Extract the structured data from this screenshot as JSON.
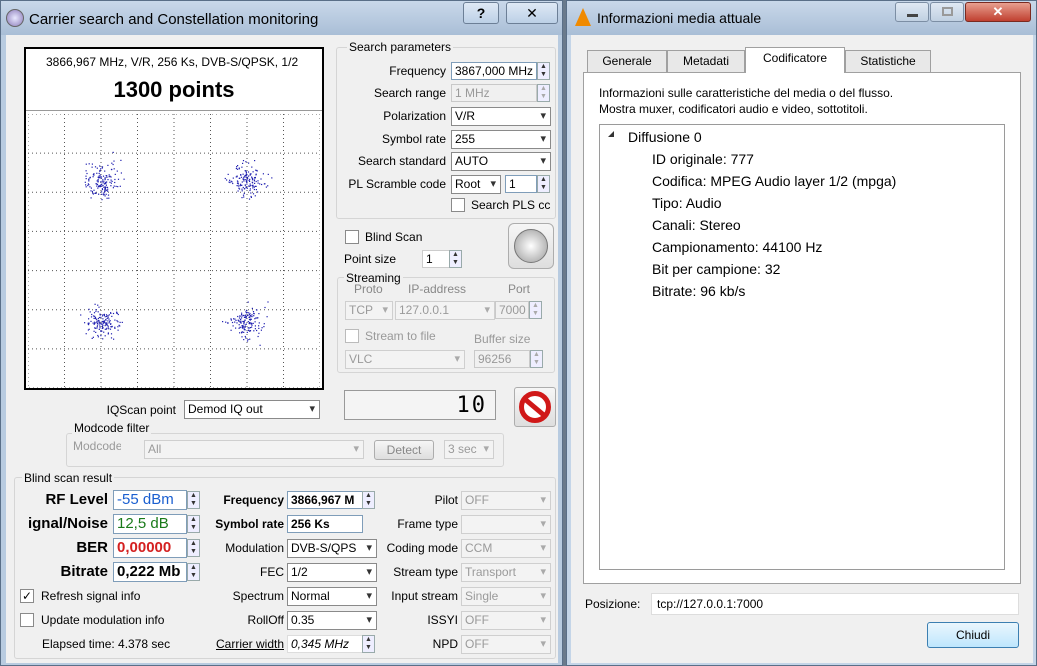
{
  "left": {
    "title": "Carrier search and Constellation monitoring",
    "help_glyph": "?",
    "close_glyph": "✕",
    "constellation": {
      "info": "3866,967 MHz, V/R, 256 Ks, DVB-S/QPSK, 1/2",
      "points": "1300 points"
    },
    "search": {
      "group": "Search parameters",
      "frequency_label": "Frequency",
      "frequency_value": "3867,000 MHz",
      "range_label": "Search range",
      "range_value": "1 MHz",
      "polarization_label": "Polarization",
      "polarization_value": "V/R",
      "symbol_label": "Symbol rate",
      "symbol_value": "255",
      "standard_label": "Search standard",
      "standard_value": "AUTO",
      "pl_label": "PL Scramble code",
      "pl_mode": "Root",
      "pl_value": "1",
      "pls_label": "Search PLS cc"
    },
    "blind_scan": "Blind Scan",
    "point_size_label": "Point size",
    "point_size_value": "1",
    "streaming": {
      "group": "Streaming",
      "proto_label": "Proto",
      "ip_label": "IP-address",
      "port_label": "Port",
      "proto": "TCP",
      "ip": "127.0.0.1",
      "port": "7000",
      "stream_to_file": "Stream to file",
      "buffer_label": "Buffer size",
      "player": "VLC",
      "buffer": "96256"
    },
    "iqscan_label": "IQScan point",
    "iqscan_value": "Demod IQ out",
    "counter": "10",
    "modcode": {
      "group": "Modcode filter",
      "label": "Modcode",
      "value": "All",
      "detect": "Detect",
      "sec": "3 sec"
    },
    "result": {
      "group": "Blind scan result",
      "rf_label": "RF Level",
      "rf_value": "-55 dBm",
      "sn_label": "ignal/Noise",
      "sn_value": "12,5 dB",
      "ber_label": "BER",
      "ber_value": "0,00000",
      "bitrate_label": "Bitrate",
      "bitrate_value": "0,222 Mb",
      "freq_label": "Frequency",
      "freq_value": "3866,967 M",
      "sr_label": "Symbol rate",
      "sr_value": "256 Ks",
      "mod_label": "Modulation",
      "mod_value": "DVB-S/QPS",
      "fec_label": "FEC",
      "fec_value": "1/2",
      "spectrum_label": "Spectrum",
      "spectrum_value": "Normal",
      "rolloff_label": "RollOff",
      "rolloff_value": "0.35",
      "carrier_label": "Carrier width",
      "carrier_value": "0,345 MHz",
      "pilot_label": "Pilot",
      "pilot_value": "OFF",
      "frame_label": "Frame type",
      "frame_value": "",
      "coding_label": "Coding mode",
      "coding_value": "CCM",
      "stream_label": "Stream type",
      "stream_value": "Transport",
      "input_label": "Input stream",
      "input_value": "Single",
      "issyi_label": "ISSYI",
      "issyi_value": "OFF",
      "npd_label": "NPD",
      "npd_value": "OFF",
      "refresh_label": "Refresh signal info",
      "update_label": "Update modulation info",
      "elapsed": "Elapsed time: 4.378 sec"
    },
    "colors": {
      "rf": "#1a5fd0",
      "sn": "#1a7a1a",
      "ber": "#d42020"
    }
  },
  "right": {
    "title": "Informazioni media attuale",
    "tabs": [
      "Generale",
      "Metadati",
      "Codificatore",
      "Statistiche"
    ],
    "desc1": "Informazioni sulle caratteristiche del media o del flusso.",
    "desc2": "Mostra muxer, codificatori audio e video, sottotitoli.",
    "stream_title": "Diffusione 0",
    "props": [
      "ID originale: 777",
      "Codifica: MPEG Audio layer 1/2 (mpga)",
      "Tipo: Audio",
      "Canali: Stereo",
      "Campionamento: 44100 Hz",
      "Bit per campione: 32",
      "Bitrate: 96 kb/s"
    ],
    "position_label": "Posizione:",
    "position_value": "tcp://127.0.0.1:7000",
    "close_button": "Chiudi"
  }
}
